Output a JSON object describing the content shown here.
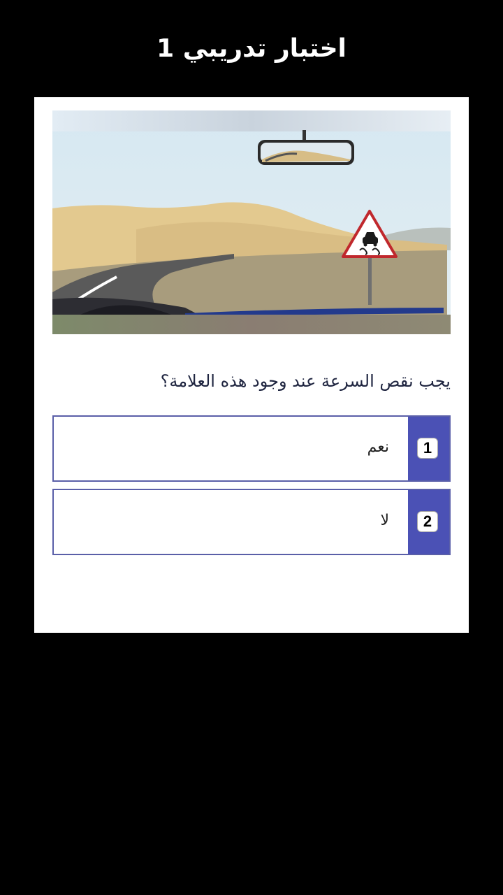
{
  "header": {
    "title": "اختبار تدريبي 1"
  },
  "question": {
    "image_alt": "road-scene-with-slippery-road-sign",
    "sign_icon": "slippery-road-sign-icon",
    "text": "يجب نقص السرعة عند وجود هذه العلامة؟"
  },
  "options": [
    {
      "number": "1",
      "label": "نعم"
    },
    {
      "number": "2",
      "label": "لا"
    }
  ],
  "colors": {
    "background": "#000000",
    "card": "#ffffff",
    "accent": "#4b51b5",
    "option_border": "#5a5fa8",
    "question_text": "#1f2540"
  }
}
